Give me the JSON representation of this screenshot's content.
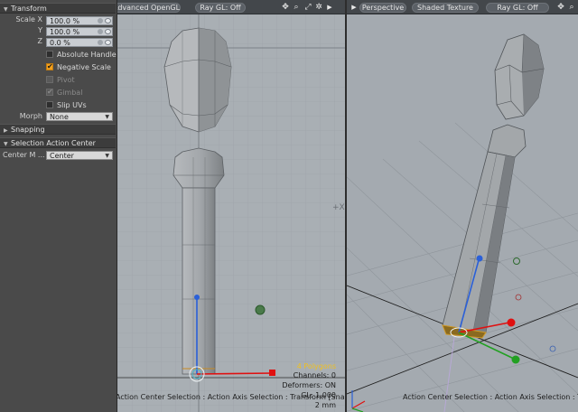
{
  "panel": {
    "transform_header": "Transform",
    "scale": {
      "x_label": "Scale X",
      "x_value": "100.0 %",
      "y_label": "Y",
      "y_value": "100.0 %",
      "z_label": "Z",
      "z_value": "0.0 %"
    },
    "options": [
      {
        "label": "Absolute Handle",
        "checked": false,
        "disabled": false
      },
      {
        "label": "Negative Scale",
        "checked": true,
        "disabled": false
      },
      {
        "label": "Pivot",
        "checked": false,
        "disabled": true
      },
      {
        "label": "Gimbal",
        "checked": true,
        "disabled": true
      },
      {
        "label": "Slip UVs",
        "checked": false,
        "disabled": false
      }
    ],
    "morph_label": "Morph",
    "morph_value": "None",
    "snapping_header": "Snapping",
    "action_center_header": "Selection Action Center",
    "center_label": "Center M ...",
    "center_value": "Center"
  },
  "viewport_left": {
    "mode_label": "Advanced OpenGL",
    "raygl_label": "Ray GL: Off",
    "hud": {
      "polygons": "4 Polygons",
      "channels": "Channels: 0",
      "deformers": "Deformers: ON",
      "gl": "GL: 1,000",
      "grid": "2 mm"
    },
    "status": "Action Center Selection : Action Axis Selection : Transform  [Snap GLAT]"
  },
  "viewport_right": {
    "view_label": "Perspective",
    "shading_label": "Shaded Texture",
    "raygl_label": "Ray GL: Off",
    "status": "Action Center Selection : Action Axis Selection : Transform"
  },
  "colors": {
    "accent_checkbox": "#f2a01d",
    "axis_x": "#e01010",
    "axis_y": "#2a9a2a",
    "axis_z": "#2b60d8",
    "hud_highlight": "#f0c020"
  }
}
